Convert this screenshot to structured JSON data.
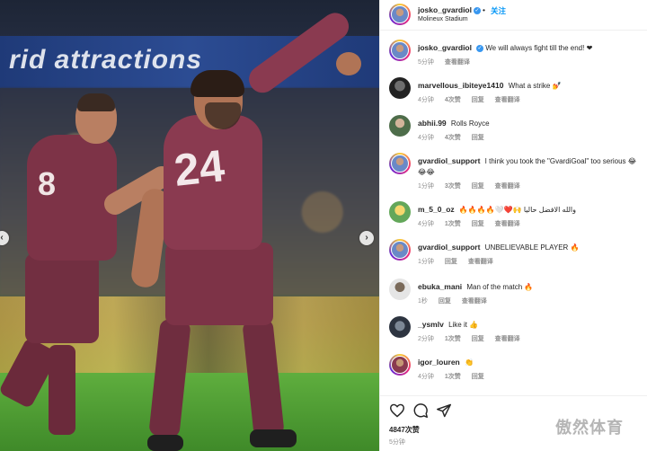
{
  "post_header": {
    "username": "josko_gvardiol",
    "separator": "•",
    "follow_label": "关注",
    "location": "Molineux Stadium"
  },
  "photo": {
    "banner_text": "rid attractions",
    "players": [
      {
        "number": "8"
      },
      {
        "number": "24"
      }
    ]
  },
  "comments": [
    {
      "username": "josko_gvardiol",
      "verified": true,
      "text": "We will always fight till the end! ❤",
      "time": "5分钟",
      "likes": "",
      "reply": "",
      "translate": "查看翻译",
      "avatar": "gv"
    },
    {
      "username": "marvellous_ibiteye1410",
      "verified": false,
      "text": "What a strike 💅",
      "time": "4分钟",
      "likes": "4次赞",
      "reply": "回复",
      "translate": "查看翻译",
      "avatar": "mi"
    },
    {
      "username": "abhii.99",
      "verified": false,
      "text": "Rolls Royce",
      "time": "4分钟",
      "likes": "4次赞",
      "reply": "回复",
      "translate": "",
      "avatar": "ab"
    },
    {
      "username": "gvardiol_support",
      "verified": false,
      "text": "I think you took the \"GvardiGoal\" too serious 😂😂😂",
      "time": "1分钟",
      "likes": "3次赞",
      "reply": "回复",
      "translate": "查看翻译",
      "avatar": "gv"
    },
    {
      "username": "m_5_0_oz",
      "verified": false,
      "text": "🔥🔥🔥🔥🤍❤️🙌 والله الافضل حاليا",
      "time": "4分钟",
      "likes": "1次赞",
      "reply": "回复",
      "translate": "查看翻译",
      "avatar": "m5"
    },
    {
      "username": "gvardiol_support",
      "verified": false,
      "text": "UNBELIEVABLE PLAYER 🔥",
      "time": "1分钟",
      "likes": "",
      "reply": "回复",
      "translate": "查看翻译",
      "avatar": "gv"
    },
    {
      "username": "ebuka_mani",
      "verified": false,
      "text": "Man of the match 🔥",
      "time": "1秒",
      "likes": "",
      "reply": "回复",
      "translate": "查看翻译",
      "avatar": "eb"
    },
    {
      "username": "_ysmlv",
      "verified": false,
      "text": "Like it 👍",
      "time": "2分钟",
      "likes": "1次赞",
      "reply": "回复",
      "translate": "查看翻译",
      "avatar": "ys"
    },
    {
      "username": "igor_louren",
      "verified": false,
      "text": "👏",
      "time": "4分钟",
      "likes": "1次赞",
      "reply": "回复",
      "translate": "",
      "avatar": "ig"
    }
  ],
  "actions": {
    "like_icon": "heart-icon",
    "comment_icon": "comment-icon",
    "share_icon": "share-icon",
    "likes_count": "4847次赞",
    "posted_ago": "5分钟"
  },
  "watermark": "傲然体育",
  "colors": {
    "accent": "#0095f6",
    "verified": "#3897f0",
    "jersey": "#8a3a50",
    "muted_text": "#8e8e8e"
  }
}
